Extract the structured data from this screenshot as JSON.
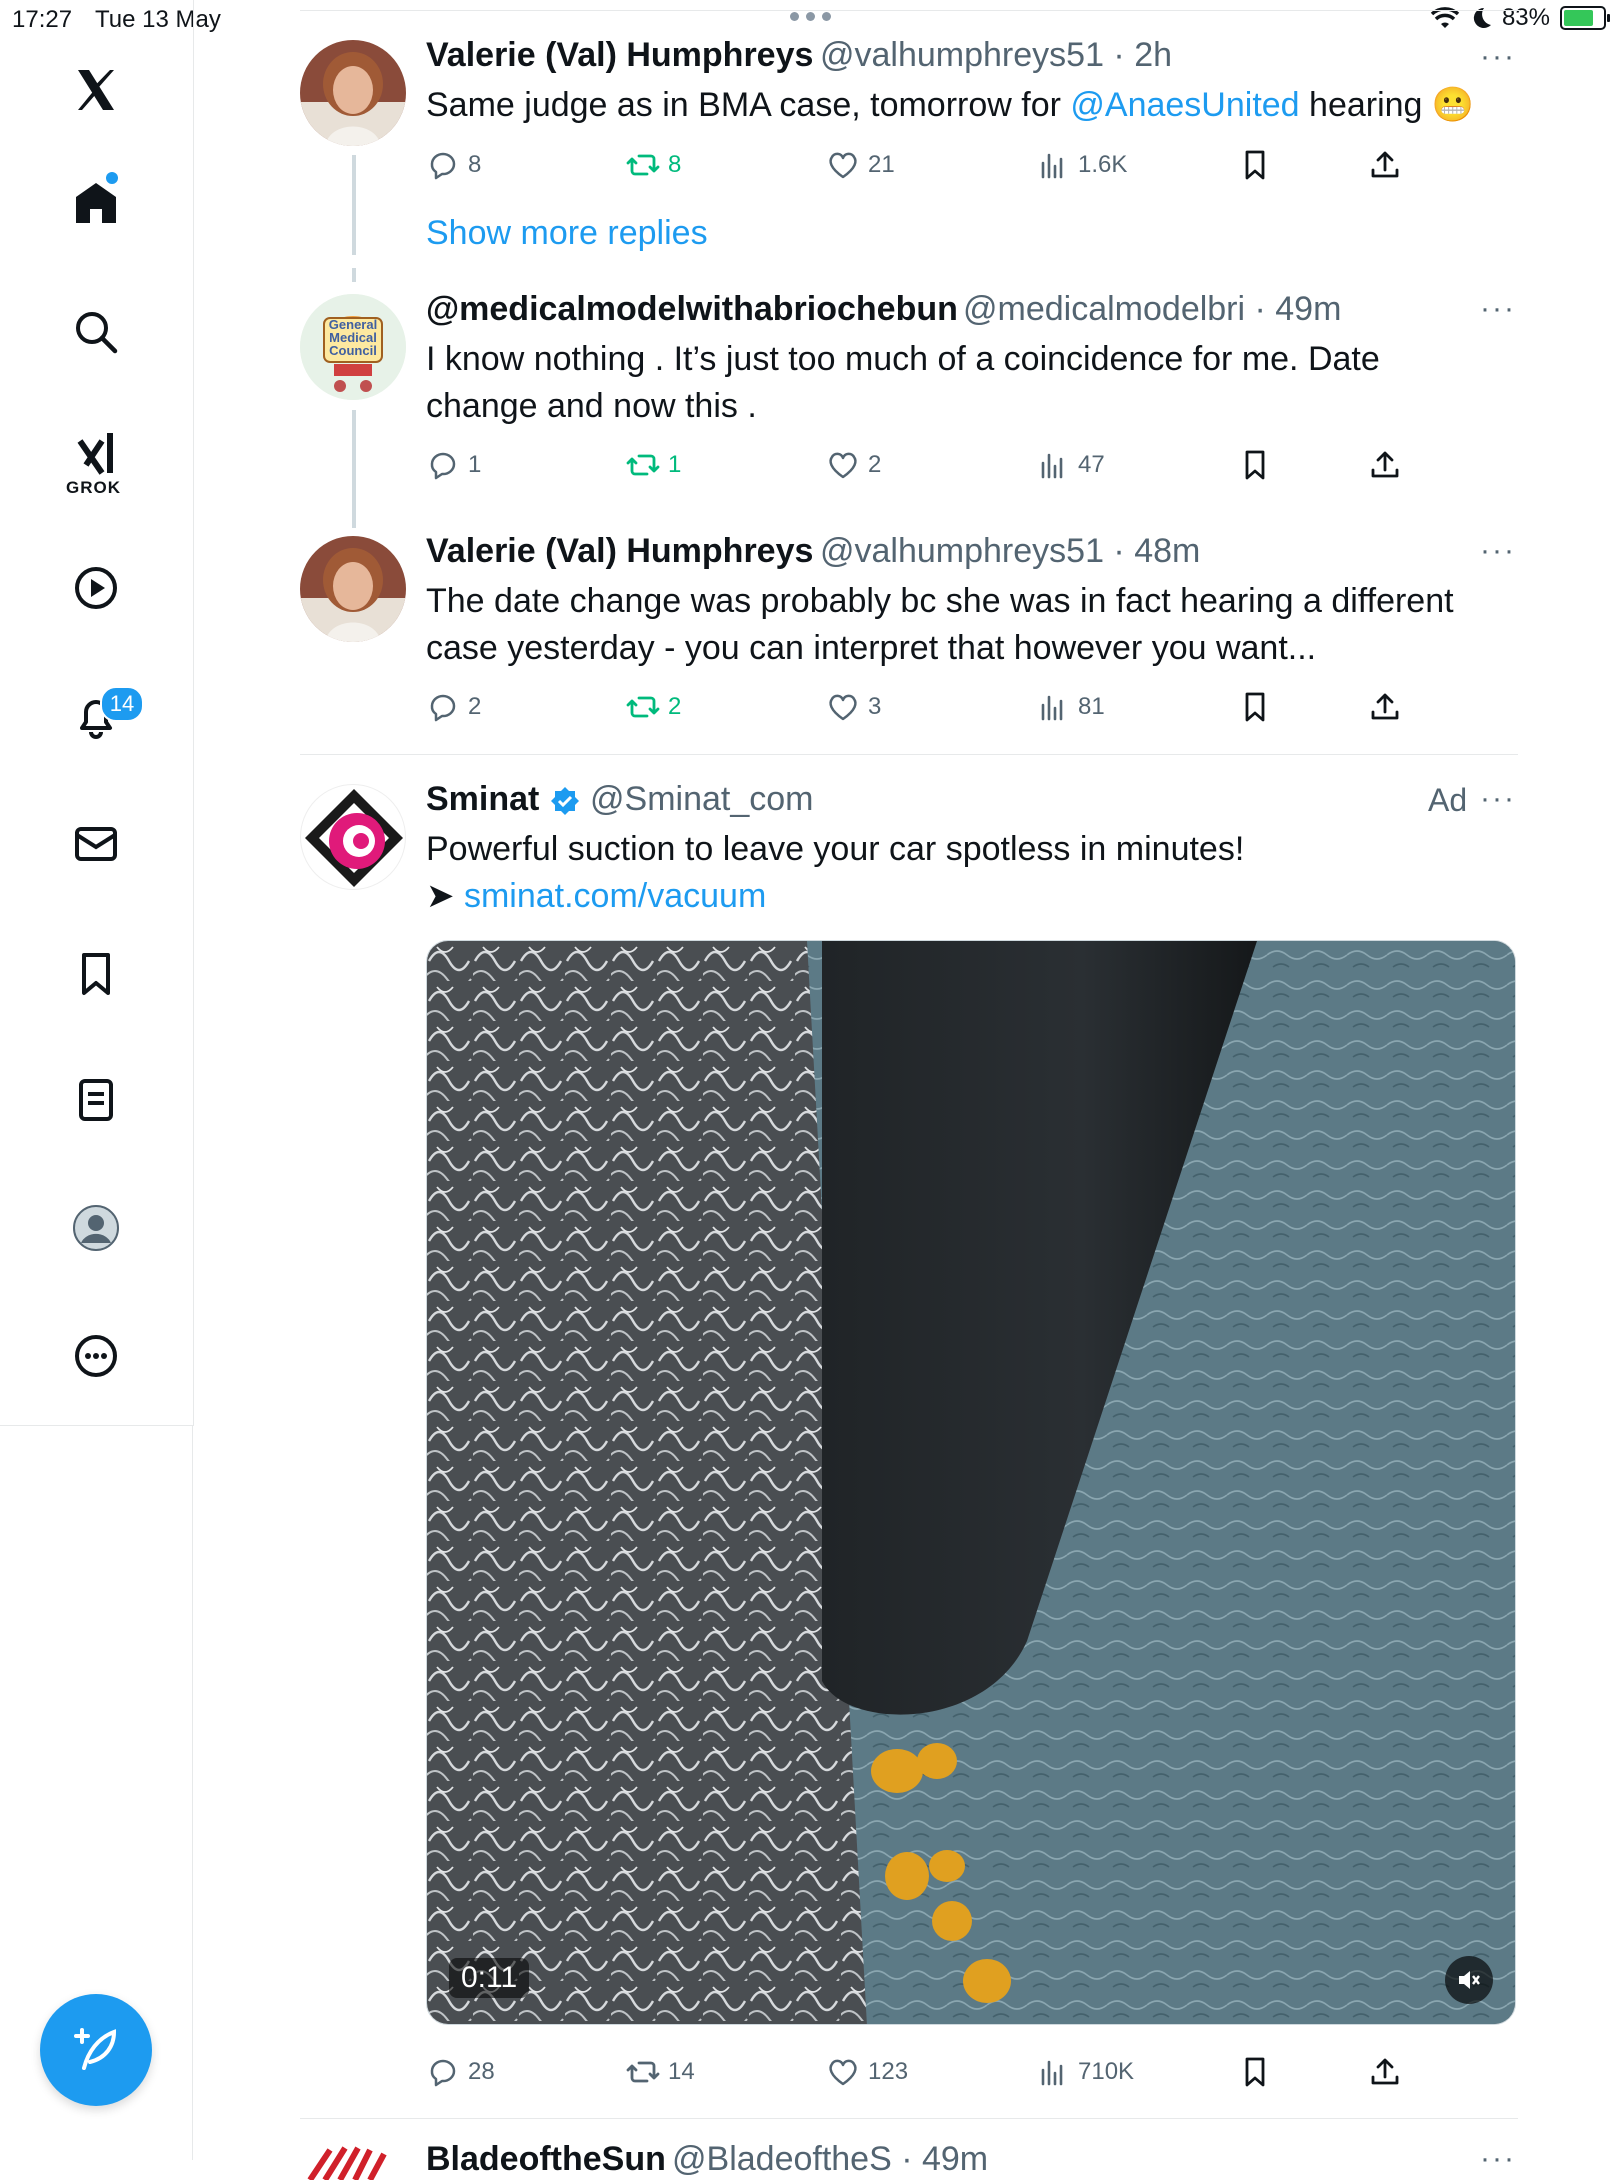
{
  "status_bar": {
    "time": "17:27",
    "date": "Tue 13 May",
    "battery": "83%"
  },
  "sidebar": {
    "notifications_badge": "14",
    "grok_label": "GROK"
  },
  "tweets": [
    {
      "name": "Valerie (Val) Humphreys",
      "meta": "@valhumphreys51 · 2h",
      "text_before": "Same judge as in BMA case, tomorrow for ",
      "mention": "@AnaesUnited",
      "text_after": "  hearing 😬",
      "replies": "8",
      "retweets": "8",
      "likes": "21",
      "views": "1.6K"
    },
    {
      "name": "@medicalmodelwithabriochebun",
      "meta": "@medicalmodelbri · 49m",
      "text": "I know nothing . It’s just too much of a coincidence for me. Date change and now this .",
      "replies": "1",
      "retweets": "1",
      "likes": "2",
      "views": "47"
    },
    {
      "name": "Valerie (Val) Humphreys",
      "meta": "@valhumphreys51 · 48m",
      "text": "The date change was probably bc she was in fact hearing a different case yesterday - you can interpret that however you want...",
      "replies": "2",
      "retweets": "2",
      "likes": "3",
      "views": "81"
    }
  ],
  "show_more_replies": "Show more replies",
  "avatar_badge_text": {
    "line1": "General",
    "line2": "Medical",
    "line3": "Council"
  },
  "ad": {
    "name": "Sminat",
    "handle": "@Sminat_com",
    "ad_label": "Ad",
    "text": "Powerful suction to leave your car spotless in minutes!",
    "arrow": "➤",
    "link": "sminat.com/vacuum",
    "video_time": "0:11",
    "replies": "28",
    "retweets": "14",
    "likes": "123",
    "views": "710K"
  },
  "next_tweet": {
    "name": "BladeoftheSun",
    "meta": "@BladeoftheS · 49m"
  }
}
